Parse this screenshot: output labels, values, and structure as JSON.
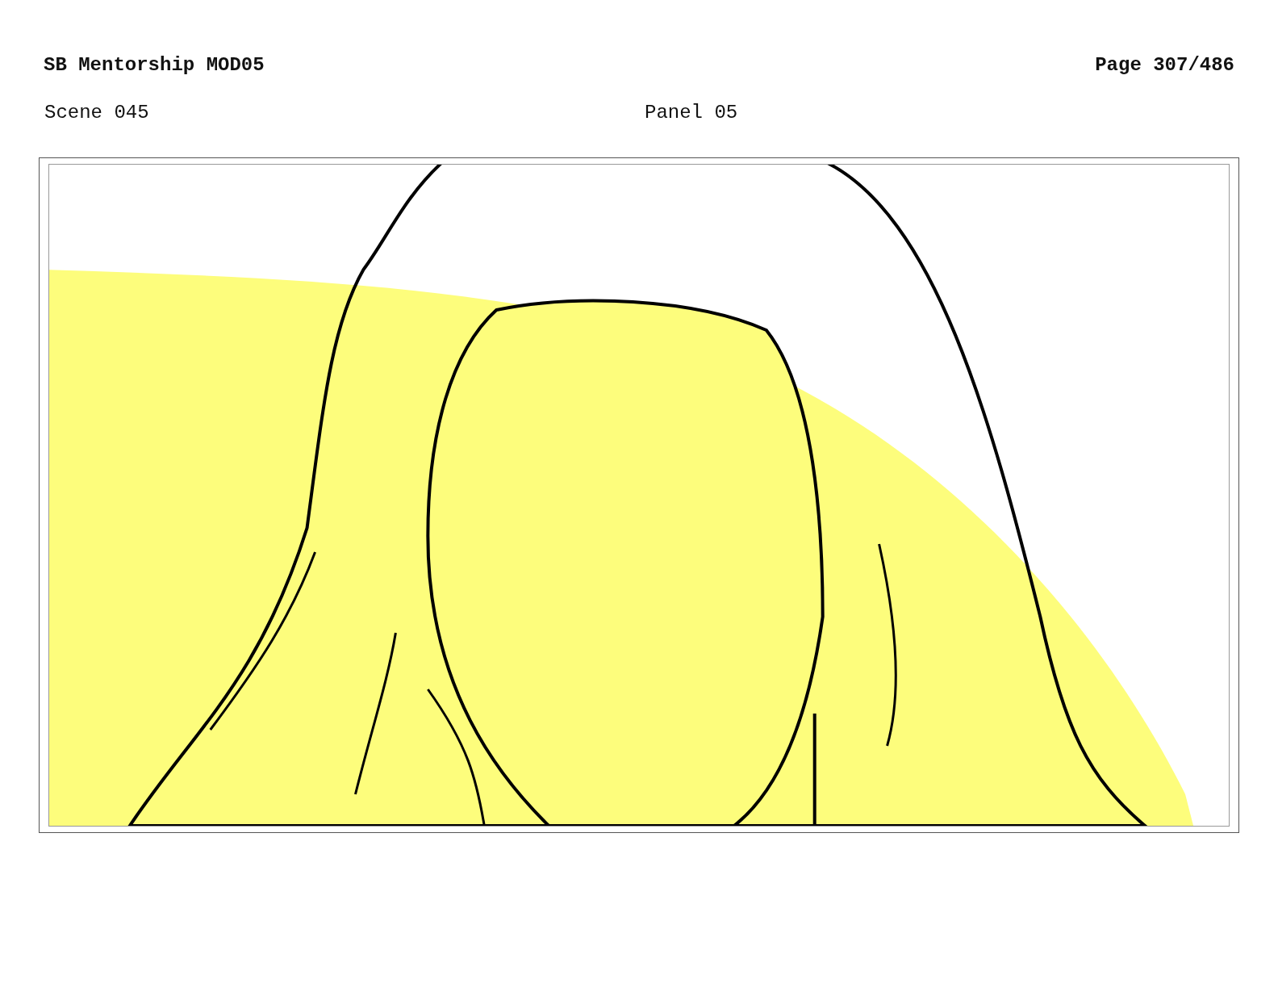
{
  "header": {
    "title": "SB Mentorship MOD05",
    "page": "Page 307/486"
  },
  "panel_info": {
    "scene": "Scene 045",
    "panel": "Panel 05"
  }
}
